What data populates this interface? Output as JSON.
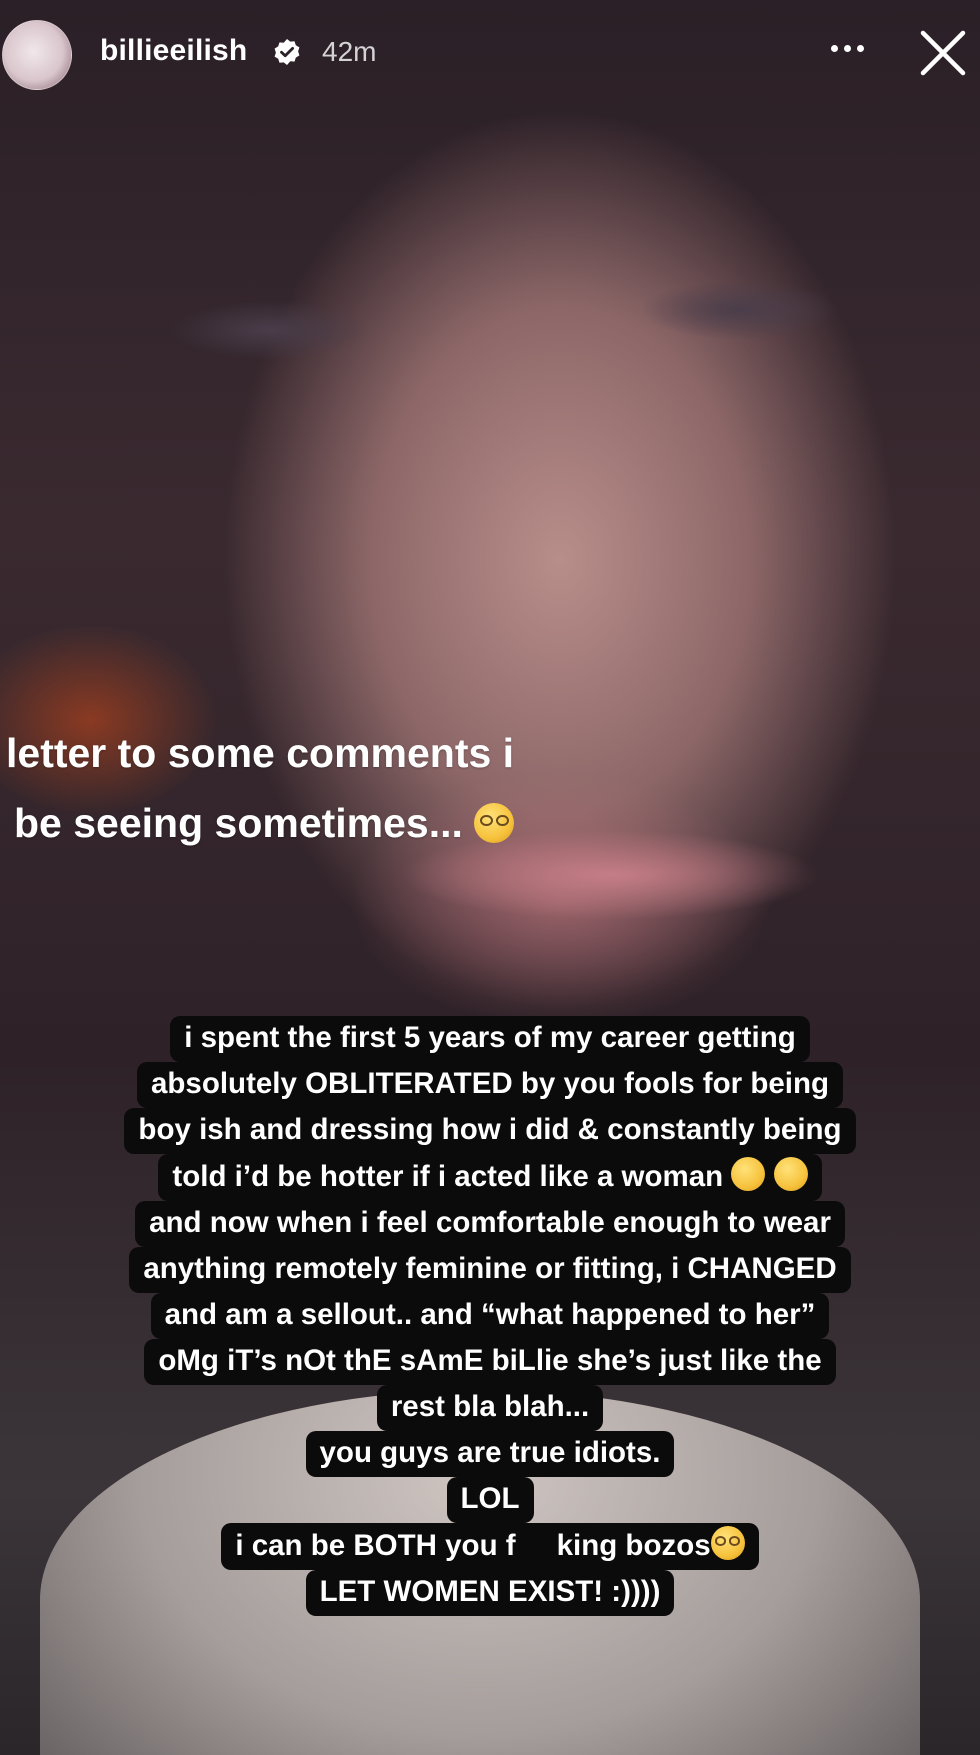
{
  "header": {
    "username": "billieeilish",
    "time_ago": "42m",
    "verified_icon": "verified-badge-icon",
    "more_icon": "more-dots-icon",
    "close_icon": "close-icon"
  },
  "caption": {
    "line1": "letter to some comments i",
    "line2": "be seeing sometimes...",
    "emoji": "nerd-face-emoji"
  },
  "text_block": {
    "lines": [
      "i spent the first 5 years of my career getting",
      "absolutely OBLITERATED by you fools for being",
      "boy ish and dressing how i did & constantly being",
      "told i’d be hotter if i acted like a woman",
      "and now when i feel comfortable enough to wear",
      "anything remotely feminine or fitting, i CHANGED",
      "and am a sellout.. and “what happened to her”",
      "oMg iT’s nOt thE sAmE biLlie she’s just like the",
      "rest bla blah...",
      "you guys are true idiots.",
      "LOL",
      "i can be BOTH you f     king bozos",
      "LET WOMEN EXIST! :))))"
    ],
    "emojis": [
      "rolling-laughing-emoji",
      "rolling-laughing-emoji",
      "nerd-face-emoji"
    ]
  },
  "colors": {
    "text_bg": "#0c0b0c",
    "text": "#ffffff"
  }
}
